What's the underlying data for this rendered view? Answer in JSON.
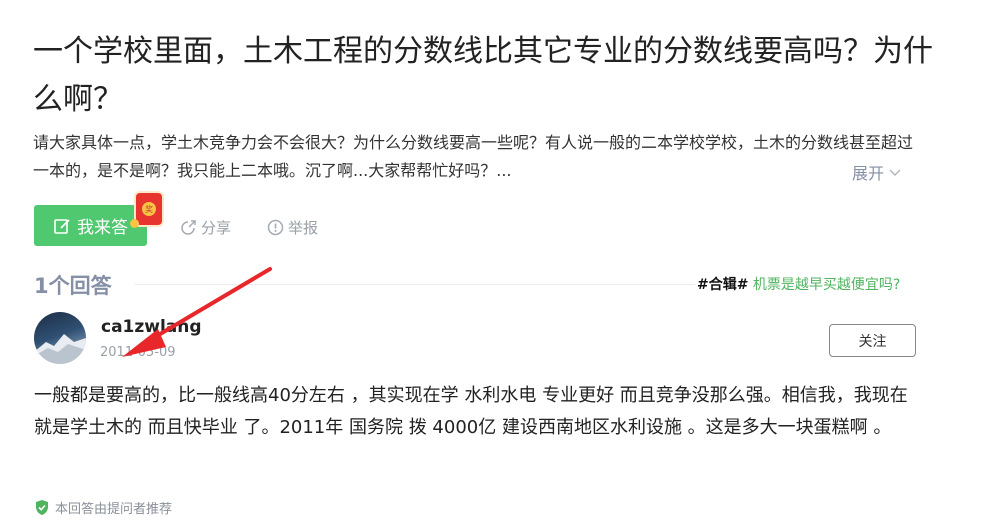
{
  "question": {
    "title": "一个学校里面，土木工程的分数线比其它专业的分数线要高吗？为什么啊？",
    "description": "请大家具体一点，学土木竞争力会不会很大？为什么分数线要高一些呢？有人说一般的二本学校学校，土木的分数线甚至超过一本的，是不是啊？我只能上二本哦。沉了啊...大家帮帮忙好吗？...",
    "expand_label": "展开",
    "answer_button_label": "我来答",
    "redpack_char": "奖",
    "share_label": "分享",
    "report_label": "举报"
  },
  "answers_header": {
    "count_label": "1个回答",
    "collection_tag": "#合辑#",
    "collection_link": "机票是越早买越便宜吗?"
  },
  "answer": {
    "username": "ca1zwlang",
    "date": "2011-05-09",
    "follow_label": "关注",
    "content": "一般都是要高的，比一般线高40分左右 ，其实现在学 水利水电 专业更好 而且竞争没那么强。相信我，我现在就是学土木的 而且快毕业 了。2011年 国务院 拨 4000亿 建设西南地区水利设施 。这是多大一块蛋糕啊 。",
    "recommend_label": "本回答由提问者推荐"
  },
  "colors": {
    "accent_green": "#4fc86f",
    "link_green": "#4fb35f",
    "annotation_red": "#e8272b"
  }
}
